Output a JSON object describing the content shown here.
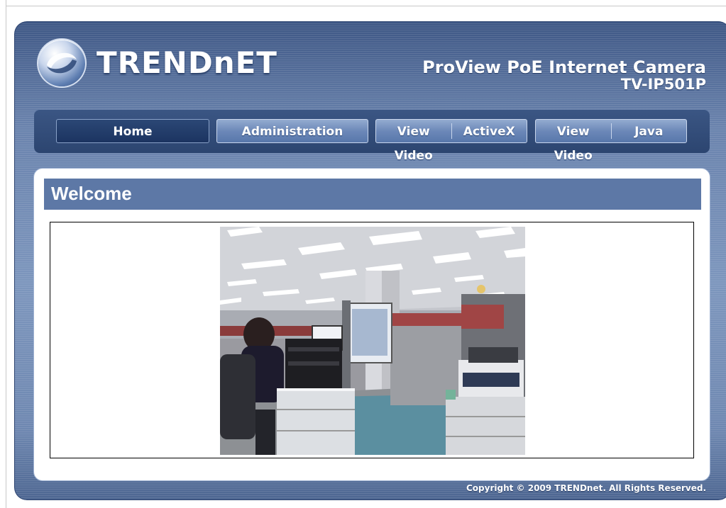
{
  "brand": {
    "logo_text": "TRENDnET",
    "logo_icon": "trendnet-swirl-icon"
  },
  "product": {
    "name": "ProView PoE Internet Camera",
    "model": "TV-IP501P"
  },
  "nav": {
    "home": "Home",
    "administration": "Administration",
    "view_video_activex": {
      "left": "View Video",
      "right": "ActiveX"
    },
    "view_video_java": {
      "left": "View Video",
      "right": "Java"
    }
  },
  "main": {
    "title": "Welcome"
  },
  "footer": {
    "copyright": "Copyright © 2009 TRENDnet. All Rights Reserved."
  },
  "colors": {
    "frame": "#6a83ad",
    "nav_bg": "#2c4570",
    "nav_active": "#1c3461",
    "welcome_bar": "#5d78a6"
  }
}
